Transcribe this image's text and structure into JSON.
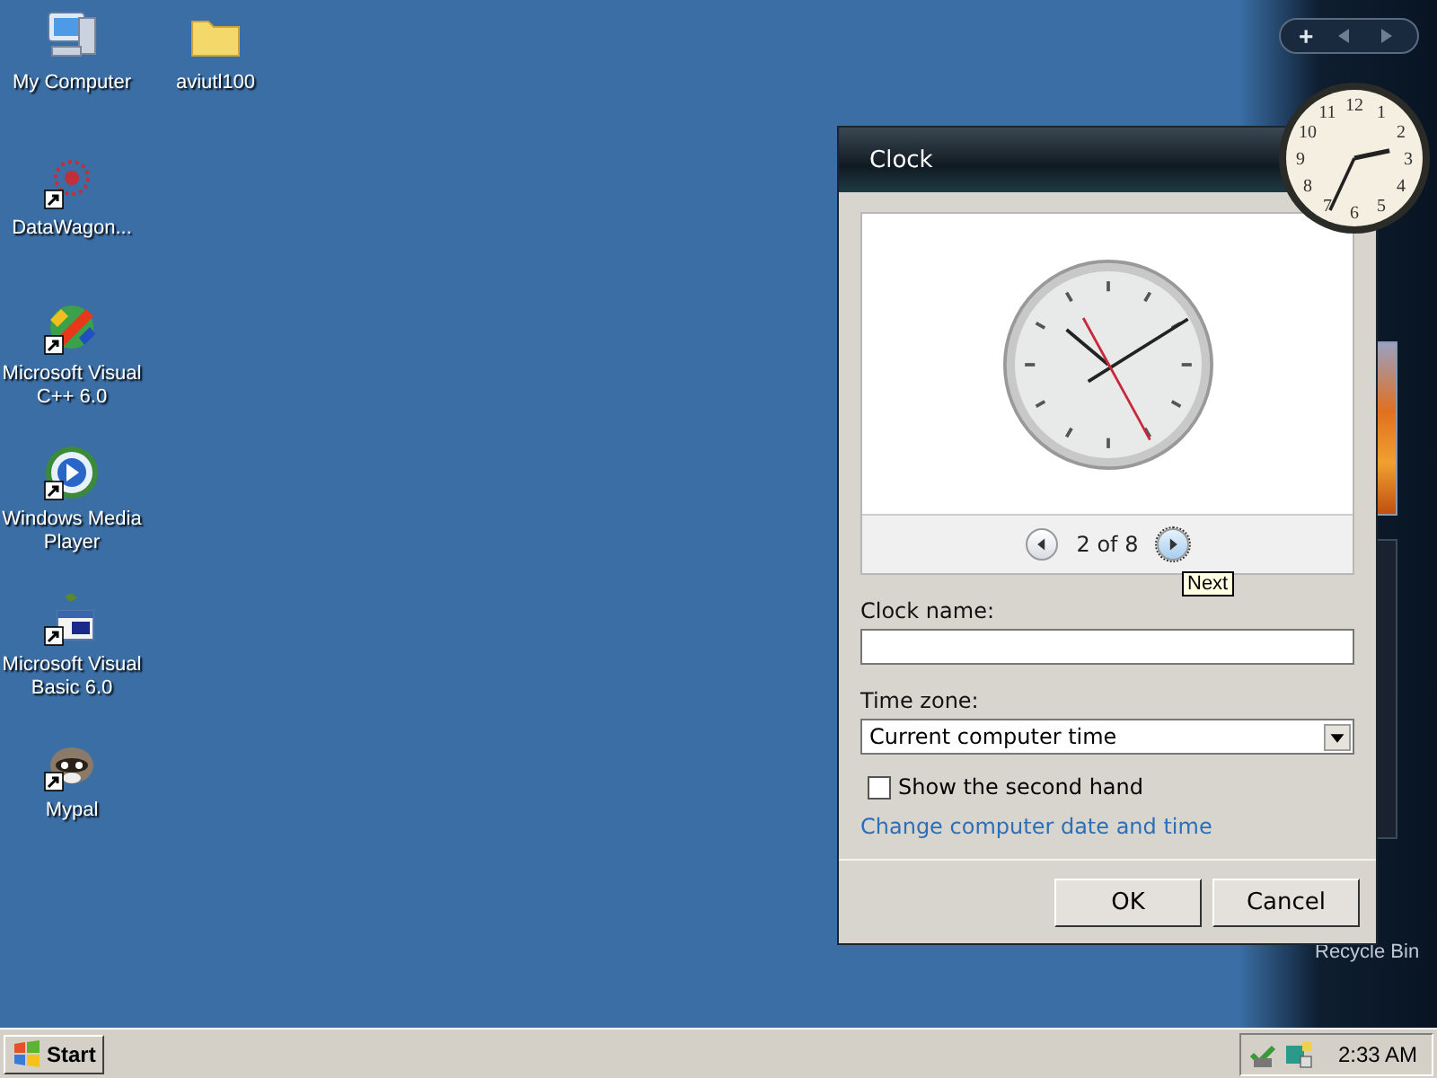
{
  "desktop": {
    "icons": [
      {
        "label": "My Computer",
        "kind": "computer",
        "shortcut": false
      },
      {
        "label": "DataWagon...",
        "kind": "target",
        "shortcut": true
      },
      {
        "label": "Microsoft Visual C++ 6.0",
        "kind": "devstudio",
        "shortcut": true
      },
      {
        "label": "Windows Media Player",
        "kind": "media",
        "shortcut": true
      },
      {
        "label": "Microsoft Visual Basic 6.0",
        "kind": "basic",
        "shortcut": true
      },
      {
        "label": "Mypal",
        "kind": "raccoon",
        "shortcut": true
      },
      {
        "label": "aviutl100",
        "kind": "folder",
        "shortcut": false
      }
    ]
  },
  "sidebar": {
    "add_button": "+",
    "recycle_bin_label": "Recycle Bin",
    "clock_gadget": {
      "numerals": [
        "12",
        "1",
        "2",
        "3",
        "4",
        "5",
        "6",
        "7",
        "8",
        "9",
        "10",
        "11"
      ]
    }
  },
  "dialog": {
    "title": "Clock",
    "pager": "2 of 8",
    "tooltip": "Next",
    "clock_name_label": "Clock name:",
    "time_zone": {
      "label": "Time zone:",
      "value": "Current computer time"
    },
    "second_hand": {
      "label": "Show the second hand",
      "checked": false
    },
    "link": "Change computer date and time",
    "buttons": [
      "OK",
      "Cancel"
    ]
  },
  "taskbar": {
    "start": "Start",
    "time": "2:33 AM"
  }
}
